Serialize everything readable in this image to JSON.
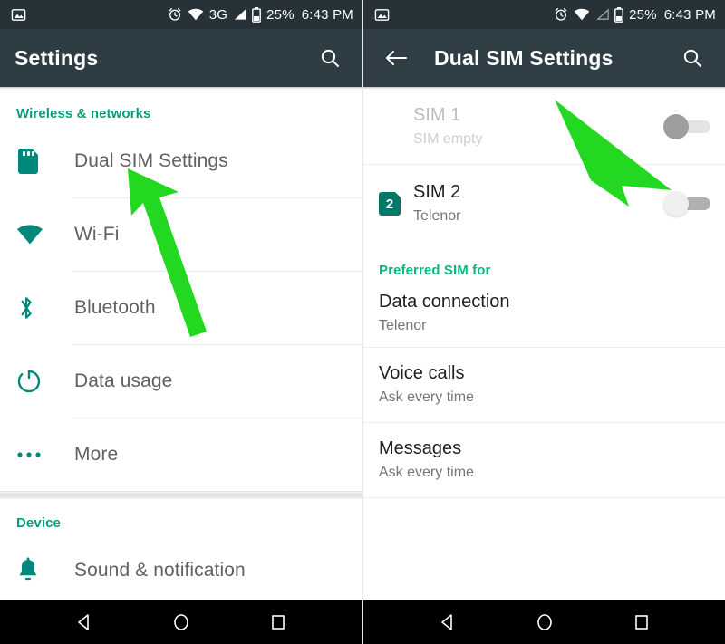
{
  "theme": {
    "status_bar_bg": "#263238",
    "toolbar_bg": "#2e3c43",
    "accent_teal": "#00a07a",
    "accent_green_header": "#00bd82",
    "icon_teal": "#00897b",
    "arrow_green": "#22d821",
    "nav_bar_bg": "#000000"
  },
  "left_panel": {
    "status_bar": {
      "image_icon": "image-icon",
      "alarm_icon": "alarm-icon",
      "wifi_icon": "wifi-icon",
      "network_label": "3G",
      "signal_icon": "signal-icon",
      "battery_icon": "battery-icon",
      "battery_percent": "25%",
      "clock": "6:43 PM"
    },
    "toolbar": {
      "title": "Settings",
      "search_icon": "search-icon"
    },
    "sections": [
      {
        "header": "Wireless & networks",
        "items": [
          {
            "label": "Dual SIM Settings",
            "icon": "sim-card-icon"
          },
          {
            "label": "Wi-Fi",
            "icon": "wifi-icon"
          },
          {
            "label": "Bluetooth",
            "icon": "bluetooth-icon"
          },
          {
            "label": "Data usage",
            "icon": "data-usage-icon"
          },
          {
            "label": "More",
            "icon": "more-dots-icon"
          }
        ]
      },
      {
        "header": "Device",
        "items": [
          {
            "label": "Sound & notification",
            "icon": "bell-icon"
          }
        ]
      }
    ],
    "nav_bar": {
      "back": "back-triangle-icon",
      "home": "home-circle-icon",
      "recents": "recents-square-icon"
    }
  },
  "right_panel": {
    "status_bar": {
      "image_icon": "image-icon",
      "alarm_icon": "alarm-icon",
      "wifi_icon": "wifi-icon",
      "signal_icon": "signal-empty-icon",
      "battery_icon": "battery-icon",
      "battery_percent": "25%",
      "clock": "6:43 PM"
    },
    "toolbar": {
      "back_icon": "back-arrow-icon",
      "title": "Dual SIM Settings",
      "search_icon": "search-icon"
    },
    "sim_slots": [
      {
        "name": "SIM 1",
        "status": "SIM empty",
        "enabled": false,
        "icon": null,
        "toggle_state": "off"
      },
      {
        "name": "SIM 2",
        "status": "Telenor",
        "enabled": true,
        "icon": "sim-2-badge-icon",
        "badge_number": "2",
        "toggle_state": "off"
      }
    ],
    "preferred_section": {
      "header": "Preferred SIM for",
      "items": [
        {
          "title": "Data connection",
          "value": "Telenor"
        },
        {
          "title": "Voice calls",
          "value": "Ask every time"
        },
        {
          "title": "Messages",
          "value": "Ask every time"
        }
      ]
    },
    "nav_bar": {
      "back": "back-triangle-icon",
      "home": "home-circle-icon",
      "recents": "recents-square-icon"
    }
  },
  "annotations": [
    {
      "name": "arrow-to-dual-sim-settings",
      "color": "#22d821",
      "points_to": "Dual SIM Settings"
    },
    {
      "name": "arrow-to-sim2-toggle",
      "color": "#22d821",
      "points_to": "SIM 2 toggle"
    }
  ]
}
